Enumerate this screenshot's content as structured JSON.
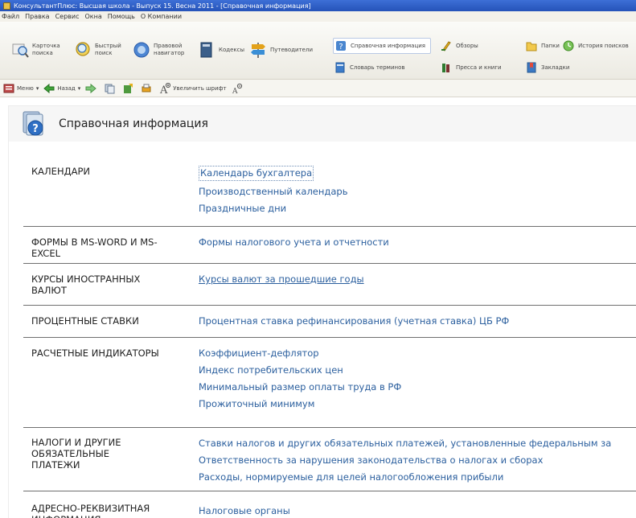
{
  "window": {
    "title": "КонсультантПлюс: Высшая школа - Выпуск 15. Весна 2011 - [Справочная информация]"
  },
  "menu": [
    "Файл",
    "Правка",
    "Сервис",
    "Окна",
    "Помощь",
    "О Компании"
  ],
  "toolbar_main": {
    "card_search": "Карточка поиска",
    "quick_search": "Быстрый поиск",
    "legal_navigator": "Правовой навигатор",
    "codes": "Кодексы",
    "guides": "Путеводители",
    "reference_info": "Справочная информация",
    "glossary": "Словарь терминов",
    "reviews": "Обзоры",
    "press_books": "Пресса и книги",
    "folders": "Папки",
    "search_history": "История поисков",
    "bookmarks": "Закладки"
  },
  "toolbar_nav": {
    "menu": "Меню",
    "back": "Назад",
    "zoom_font": "Увеличить шрифт"
  },
  "page": {
    "title": "Справочная информация"
  },
  "rows": [
    {
      "category": "КАЛЕНДАРИ",
      "links": [
        "Календарь бухгалтера",
        "Производственный календарь",
        "Праздничные дни"
      ]
    },
    {
      "category": "ФОРМЫ В MS-WORD И MS-EXCEL",
      "links": [
        "Формы налогового учета и отчетности"
      ]
    },
    {
      "category": "КУРСЫ ИНОСТРАННЫХ ВАЛЮТ",
      "links": [
        "Курсы валют за прошедшие годы"
      ]
    },
    {
      "category": "ПРОЦЕНТНЫЕ СТАВКИ",
      "links": [
        "Процентная ставка рефинансирования (учетная ставка) ЦБ РФ"
      ]
    },
    {
      "category": "РАСЧЕТНЫЕ ИНДИКАТОРЫ",
      "links": [
        "Коэффициент-дефлятор",
        "Индекс потребительских цен",
        "Минимальный размер оплаты труда в РФ",
        "Прожиточный минимум"
      ]
    },
    {
      "category": "НАЛОГИ И ДРУГИЕ ОБЯЗАТЕЛЬНЫЕ ПЛАТЕЖИ",
      "links": [
        "Ставки налогов и других обязательных платежей, установленные федеральным за",
        "Ответственность за нарушения законодательства о налогах и сборах",
        "Расходы, нормируемые для целей налогообложения прибыли"
      ]
    },
    {
      "category": "АДРЕСНО-РЕКВИЗИТНАЯ ИНФОРМАЦИЯ",
      "links": [
        "Налоговые органы"
      ]
    }
  ],
  "colors": {
    "link": "#2b5f9e",
    "titlebar": "#2b5bc4",
    "header_bg": "#f6f6f6"
  }
}
